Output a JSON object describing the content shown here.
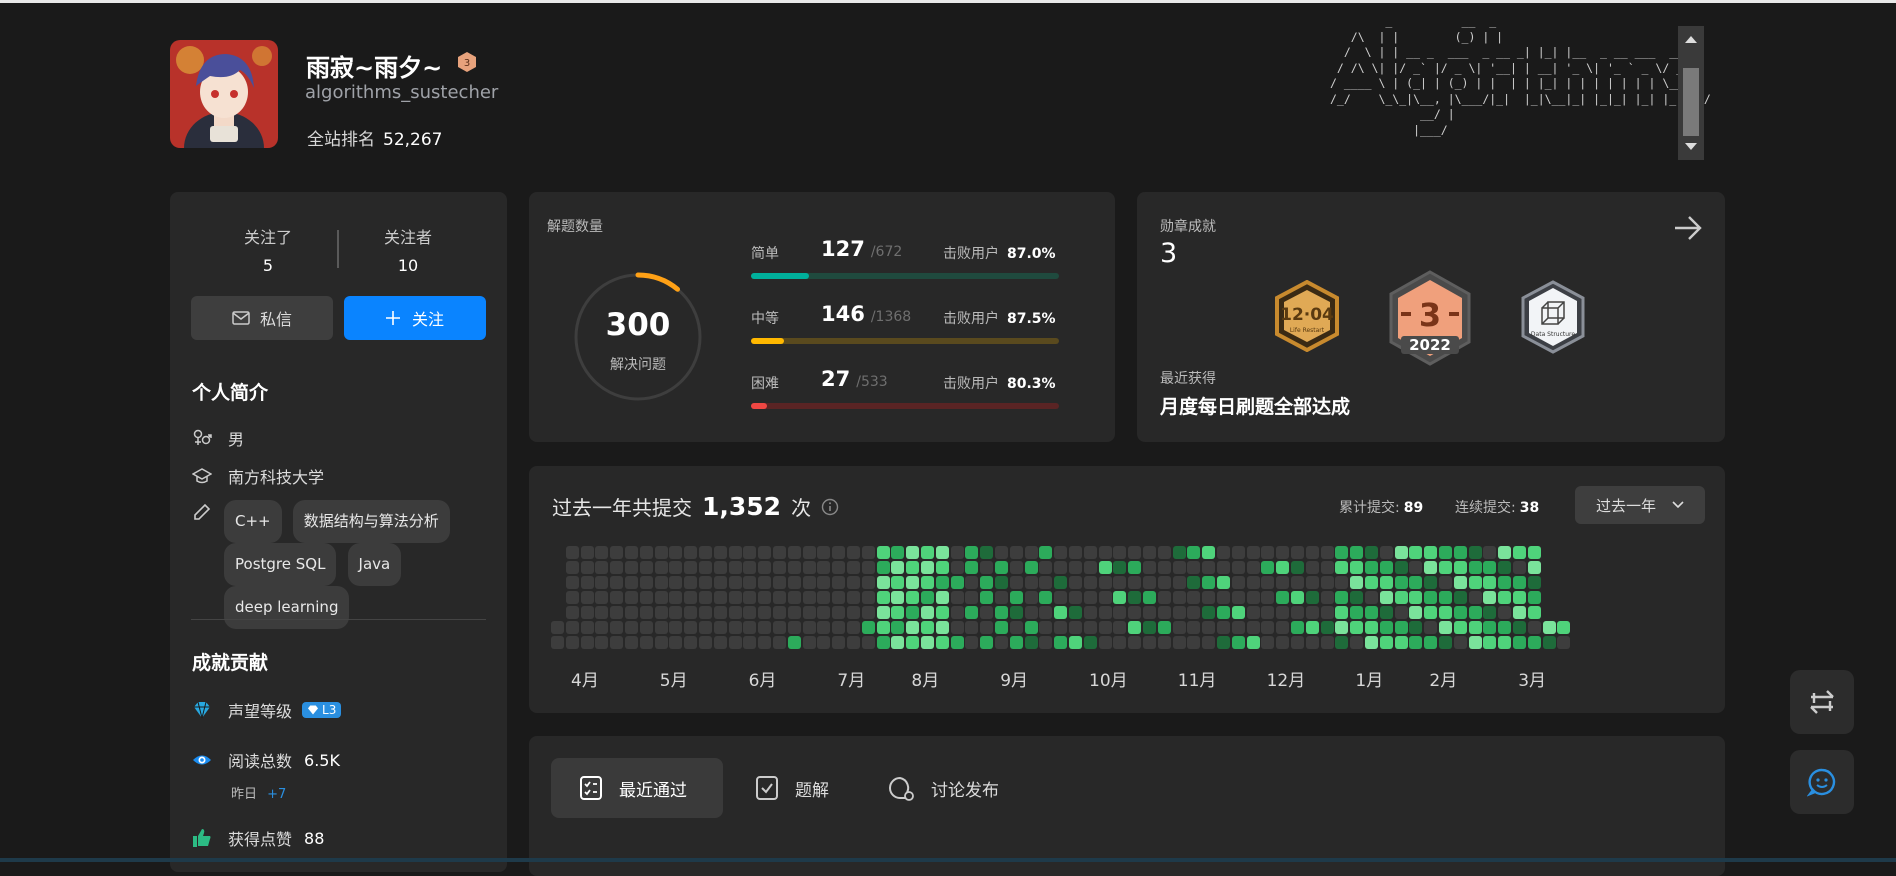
{
  "profile": {
    "display_name": "雨寂~雨夕~",
    "level_badge": "3",
    "username": "algorithms_sustecher",
    "rank_label": "全站排名",
    "rank_value": "52,267"
  },
  "ascii_art": "        _          __  _\n   /\\  | |        (_) | |\n  /  \\ | | __ _  ___  _ __ _| |_| |__  _ __ ___  ___\n / /\\ \\| |/ _` |/ _ \\| '__| | __| '_ \\| '_ ` _ \\/ __|\n/ ____ \\ | (_| | (_) | |  | | |_| | | | | | | | \\__ \\\n/_/    \\_\\_|\\__, |\\___/|_|  |_|\\__|_| |_|_| |_| |_|___/\n             __/ |\n            |___/",
  "social": {
    "following_label": "关注了",
    "following_count": "5",
    "followers_label": "关注者",
    "followers_count": "10",
    "message_label": "私信",
    "follow_label": "关注"
  },
  "bio": {
    "title": "个人简介",
    "gender": "男",
    "school": "南方科技大学",
    "tags": [
      "C++",
      "数据结构与算法分析",
      "Postgre SQL",
      "Java",
      "deep learning"
    ]
  },
  "contrib": {
    "title": "成就贡献",
    "reputation_label": "声望等级",
    "reputation_badge": "L3",
    "reads_label": "阅读总数",
    "reads_value": "6.5K",
    "yesterday_label": "昨日",
    "yesterday_value": "+7",
    "likes_label": "获得点赞",
    "likes_value": "88"
  },
  "solved": {
    "title": "解题数量",
    "total": "300",
    "total_label": "解决问题",
    "beat_label": "击败用户",
    "easy": {
      "label": "简单",
      "count": "127",
      "total": "/672",
      "beat": "87.0%",
      "progress": 0.189,
      "color": "#00af9b"
    },
    "medium": {
      "label": "中等",
      "count": "146",
      "total": "/1368",
      "beat": "87.5%",
      "progress": 0.107,
      "color": "#ffb800"
    },
    "hard": {
      "label": "困难",
      "count": "27",
      "total": "/533",
      "beat": "80.3%",
      "progress": 0.051,
      "color": "#ef4743"
    },
    "ring_progress": 0.11
  },
  "badges": {
    "title": "勋章成就",
    "count": "3",
    "recent_label": "最近获得",
    "recent_name": "月度每日刷题全部达成",
    "items": [
      {
        "name": "Life Restart",
        "text": "12·04",
        "color": "#c88a2e"
      },
      {
        "name": "2022",
        "text": "3",
        "color": "#e98a66"
      },
      {
        "name": "Data Structure",
        "text": "Data Structure",
        "color": "#cfd3da"
      }
    ]
  },
  "submissions": {
    "title_prefix": "过去一年共提交",
    "count": "1,352",
    "title_suffix": "次",
    "total_label": "累计提交:",
    "total_value": "89",
    "streak_label": "连续提交:",
    "streak_value": "38",
    "range_label": "过去一年",
    "months": [
      "4月",
      "5月",
      "6月",
      "7月",
      "8月",
      "9月",
      "10月",
      "11月",
      "12月",
      "1月",
      "2月",
      "3月"
    ]
  },
  "tabs": [
    {
      "label": "最近通过",
      "icon": "checklist-icon",
      "active": true
    },
    {
      "label": "题解",
      "icon": "checkbox-icon",
      "active": false
    },
    {
      "label": "讨论发布",
      "icon": "discussion-icon",
      "active": false
    }
  ],
  "colors": {
    "accent": "#0a84ff",
    "card": "#282828",
    "bg": "#1a1a1a"
  }
}
